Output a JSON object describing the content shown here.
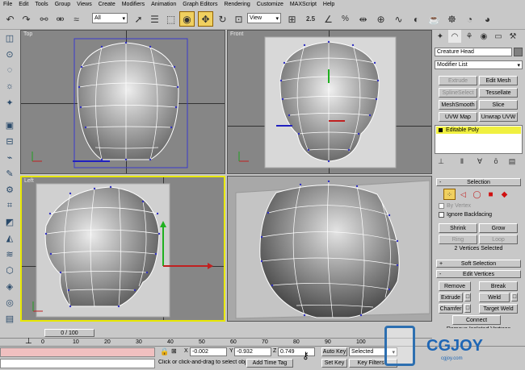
{
  "menu": [
    "File",
    "Edit",
    "Tools",
    "Group",
    "Views",
    "Create",
    "Modifiers",
    "Animation",
    "Graph Editors",
    "Rendering",
    "Customize",
    "MAXScript",
    "Help"
  ],
  "toolbar": {
    "selection_filter": "All",
    "reference_coord": "View",
    "snap_label": "2.5",
    "snap_percent": "%"
  },
  "viewports": {
    "top": "Top",
    "front": "Front",
    "left": "Left",
    "perspective": ""
  },
  "panel": {
    "object_name": "Creature Head",
    "modifier_list": "Modifier List",
    "buttons": {
      "extrude": "Extrude",
      "edit_mesh": "Edit Mesh",
      "spline_select": "SplineSelect",
      "tessellate": "Tessellate",
      "meshsmooth": "MeshSmooth",
      "slice": "Slice",
      "uvw_map": "UVW Map",
      "unwrap_uvw": "Unwrap UVW"
    },
    "stack_item": "Editable Poly",
    "selection": {
      "title": "Selection",
      "by_vertex": "By Vertex",
      "ignore_backfacing": "Ignore Backfacing",
      "shrink": "Shrink",
      "grow": "Grow",
      "ring": "Ring",
      "loop": "Loop",
      "status": "2 Vertices Selected"
    },
    "soft_selection": "Soft Selection",
    "edit_vertices": {
      "title": "Edit Vertices",
      "remove": "Remove",
      "break": "Break",
      "extrude": "Extrude",
      "weld": "Weld",
      "chamfer": "Chamfer",
      "target_weld": "Target Weld",
      "connect": "Connect",
      "remove_isolated": "Remove Isolated Vertices"
    }
  },
  "timeline": {
    "frame": "0 / 100",
    "ticks": [
      "0",
      "10",
      "20",
      "30",
      "40",
      "50",
      "60",
      "70",
      "80",
      "90",
      "100"
    ]
  },
  "status": {
    "x_label": "X",
    "x": "-0.002",
    "y_label": "Y",
    "y": "-0.932",
    "z_label": "Z",
    "z": "0.749",
    "auto_key": "Auto Key",
    "selected": "Selected",
    "set_key": "Set Key",
    "key_filters": "Key Filters...",
    "prompt": "Click or click-and-drag to select obj",
    "add_time_tag": "Add Time Tag",
    "watermark": "CGJOY",
    "watermark_sub": "cgjoy.com"
  },
  "colors": {
    "ui": "#c8c8c8",
    "viewport": "#868686",
    "active_border": "#e8e800",
    "mesh_wire": "#ffffff",
    "vertex": "#3030c0"
  }
}
